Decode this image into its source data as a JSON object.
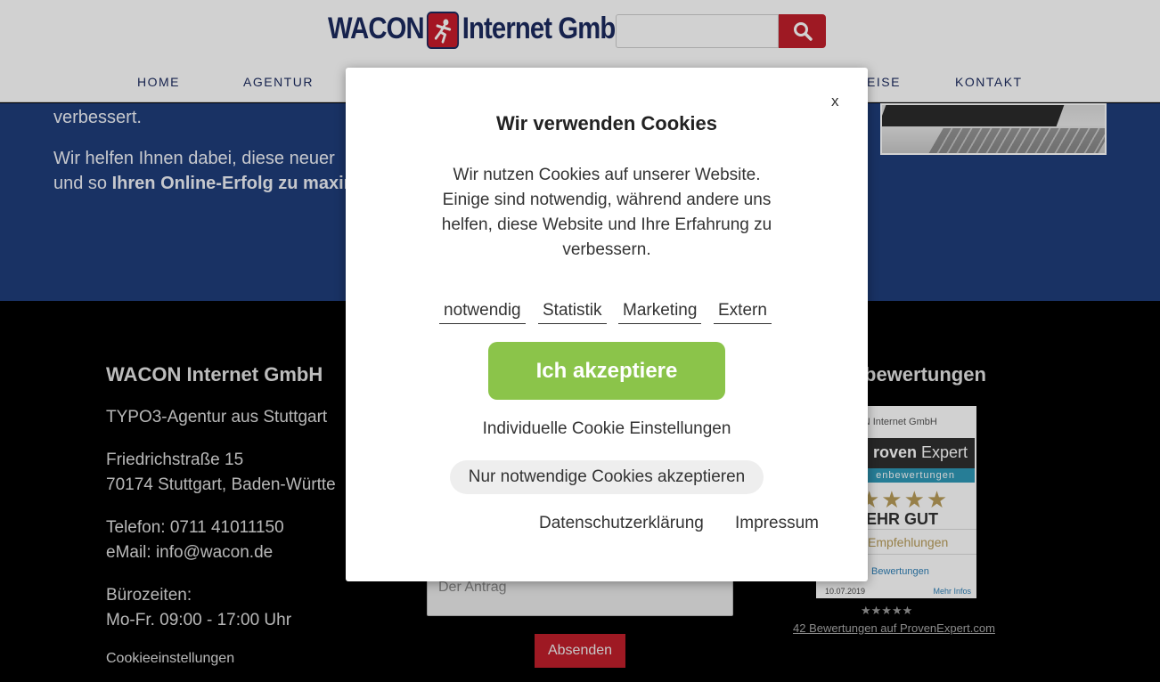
{
  "header": {
    "logo_left": "WACON",
    "logo_right": "Internet GmbH",
    "search_placeholder": "",
    "nav": [
      "HOME",
      "AGENTUR",
      "EISE",
      "KONTAKT"
    ]
  },
  "intro": {
    "line1": "verbessert.",
    "line2": "Wir helfen Ihnen dabei, diese neuer",
    "line3_plain": "und so ",
    "line3_bold": "Ihren Online-Erfolg zu maxin"
  },
  "footer": {
    "company_title": "WACON Internet GmbH",
    "tagline": "TYPO3-Agentur aus Stuttgart",
    "street": "Friedrichstraße 15",
    "city": "70174 Stuttgart, Baden-Württe",
    "phone": "Telefon: 0711 41011150",
    "email": "eMail: info@wacon.de",
    "hours_label": "Bürozeiten:",
    "hours": "Mo-Fr. 09:00 - 17:00 Uhr",
    "cookie_link": "Cookieeinstellungen",
    "reviews_title": "bewertungen",
    "send_button": "Absenden",
    "textarea_partial": "Der Antrag"
  },
  "proven_expert": {
    "company": "ON Internet GmbH",
    "brand_bold": "roven",
    "brand_light": " Expert",
    "subbar": "enbewertungen",
    "stars": "★★★★",
    "rating": "EHR GUT",
    "recommendations": "Empfehlungen",
    "reviews_link": "Bewertungen",
    "date": "10.07.2019",
    "more": "Mehr Infos",
    "mini_stars": "★★★★★",
    "footer_link": "42 Bewertungen auf ProvenExpert.com"
  },
  "cookie_modal": {
    "close": "x",
    "title": "Wir verwenden Cookies",
    "text": "Wir nutzen Cookies auf unserer Website. Einige sind notwendig, während andere uns helfen, diese Website und Ihre Erfahrung zu verbessern.",
    "categories": [
      "notwendig",
      "Statistik",
      "Marketing",
      "Extern"
    ],
    "accept_button": "Ich akzeptiere",
    "individual_settings": "Individuelle Cookie Einstellungen",
    "only_necessary_button": "Nur notwendige Cookies akzeptieren",
    "privacy_link": "Datenschutzerklärung",
    "imprint_link": "Impressum"
  },
  "colors": {
    "brand_navy": "#1b2a5e",
    "brand_red": "#c11f2b",
    "intro_blue": "#1f3d7a",
    "accept_green": "#8bc44a"
  }
}
